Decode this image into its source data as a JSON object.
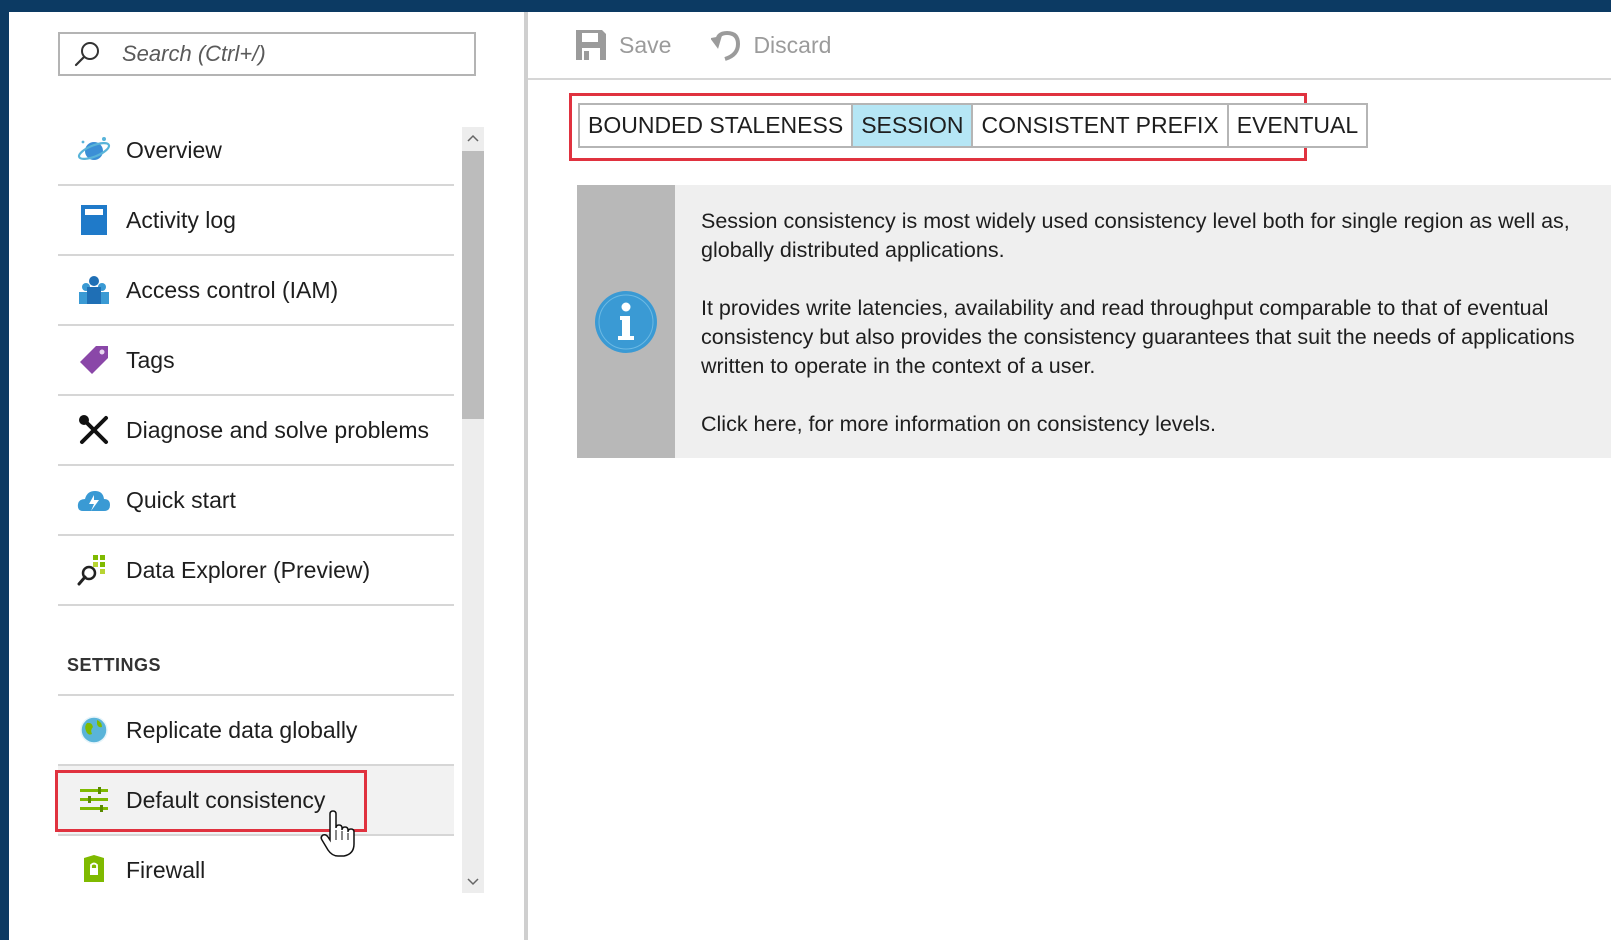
{
  "search": {
    "placeholder": "Search (Ctrl+/)"
  },
  "nav": {
    "items": [
      {
        "label": "Overview",
        "icon": "cosmos-planet-icon"
      },
      {
        "label": "Activity log",
        "icon": "activity-log-icon"
      },
      {
        "label": "Access control (IAM)",
        "icon": "iam-users-icon"
      },
      {
        "label": "Tags",
        "icon": "tag-icon"
      },
      {
        "label": "Diagnose and solve problems",
        "icon": "wrench-screwdriver-icon"
      },
      {
        "label": "Quick start",
        "icon": "cloud-lightning-icon"
      },
      {
        "label": "Data Explorer (Preview)",
        "icon": "data-explorer-icon"
      }
    ],
    "settings_header": "SETTINGS",
    "settings_items": [
      {
        "label": "Replicate data globally",
        "icon": "globe-icon"
      },
      {
        "label": "Default consistency",
        "icon": "sliders-icon"
      },
      {
        "label": "Firewall",
        "icon": "firewall-shield-icon"
      }
    ]
  },
  "toolbar": {
    "save_label": "Save",
    "discard_label": "Discard"
  },
  "consistency": {
    "tabs": [
      "BOUNDED STALENESS",
      "SESSION",
      "CONSISTENT PREFIX",
      "EVENTUAL"
    ],
    "selected": "SESSION"
  },
  "info": {
    "para1": "Session consistency is most widely used consistency level both for single region as well as, globally distributed applications.",
    "para2": "It provides write latencies, availability and read throughput comparable to that of eventual consistency but also provides the consistency guarantees that suit the needs of applications written to operate in the context of a user.",
    "link": "Click here, for more information on consistency levels."
  },
  "colors": {
    "azure_dark_blue": "#0c3a63",
    "selected_tab": "#b5e6f5",
    "highlight_red": "#e0323f",
    "info_blue": "#3a9ad4"
  }
}
